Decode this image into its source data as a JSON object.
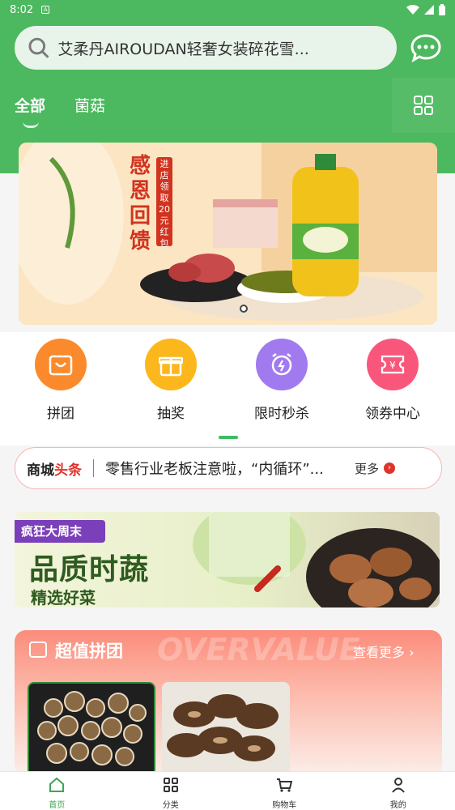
{
  "status_bar": {
    "time": "8:02",
    "a_label": "A"
  },
  "header": {
    "search_text": "艾柔丹AIROUDAN轻奢女装碎花雪...",
    "tabs": [
      {
        "label": "全部"
      },
      {
        "label": "菌菇"
      }
    ]
  },
  "banner": {
    "title": "感恩回馈",
    "tag": "进店领取20元红包"
  },
  "quick_menu": [
    {
      "label": "拼团",
      "icon": "bag-icon",
      "color": "#fb8a2c"
    },
    {
      "label": "抽奖",
      "icon": "gift-icon",
      "color": "#fbb71c"
    },
    {
      "label": "限时秒杀",
      "icon": "alarm-clock-icon",
      "color": "#a27af0"
    },
    {
      "label": "领券中心",
      "icon": "coupon-icon",
      "color": "#f8577b"
    }
  ],
  "news": {
    "brand_part1": "商城",
    "brand_part2": "头条",
    "text": "零售行业老板注意啦，“内循环”...",
    "more": "更多"
  },
  "promo": {
    "ribbon": "疯狂大周末",
    "title": "品质时蔬",
    "subtitle": "精选好菜"
  },
  "group_buy": {
    "title": "超值拼团",
    "watermark": "OVERVALUE",
    "more": "查看更多"
  },
  "tab_bar": [
    {
      "label": "首页",
      "icon": "home-icon"
    },
    {
      "label": "分类",
      "icon": "category-grid-icon"
    },
    {
      "label": "购物车",
      "icon": "cart-icon"
    },
    {
      "label": "我的",
      "icon": "profile-icon"
    }
  ],
  "colors": {
    "primary_green": "#4cb85f",
    "accent_red": "#e0322a"
  }
}
